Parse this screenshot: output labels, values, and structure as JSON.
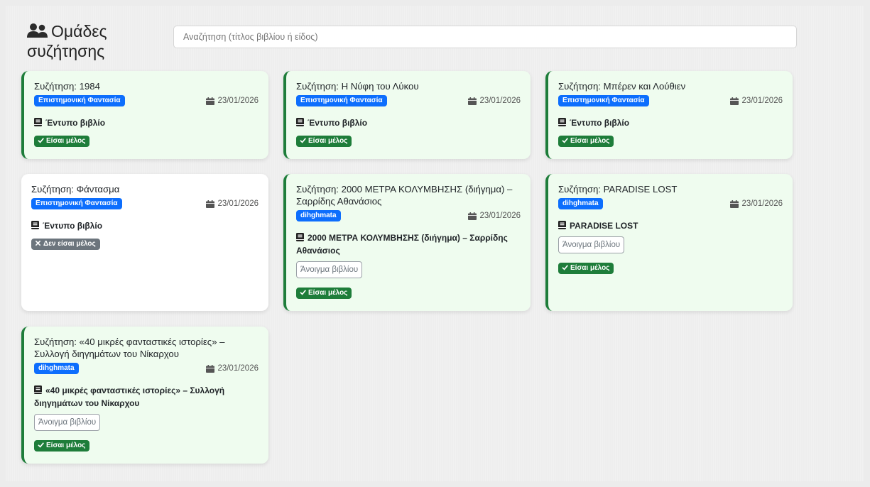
{
  "header": {
    "title": "Ομάδες συζήτησης",
    "title_icon": "users-icon",
    "search_placeholder": "Αναζήτηση (τίτλος βιβλίου ή είδος)"
  },
  "colors": {
    "accent_primary": "#0d6efd",
    "member_green": "#1e7d3a",
    "member_card_bg": "#effcef",
    "nonmember_badge": "#6c757d"
  },
  "cards": [
    {
      "title": "Συζήτηση: 1984",
      "genre": "Επιστημονική Φαντασία",
      "date": "23/01/2026",
      "book": "Έντυπο βιβλίο",
      "open_button": "",
      "status": "Είσαι μέλος",
      "member": true
    },
    {
      "title": "Συζήτηση: Η Νύφη του Λύκου",
      "genre": "Επιστημονική Φαντασία",
      "date": "23/01/2026",
      "book": "Έντυπο βιβλίο",
      "open_button": "",
      "status": "Είσαι μέλος",
      "member": true
    },
    {
      "title": "Συζήτηση: Μπέρεν και Λούθιεν",
      "genre": "Επιστημονική Φαντασία",
      "date": "23/01/2026",
      "book": "Έντυπο βιβλίο",
      "open_button": "",
      "status": "Είσαι μέλος",
      "member": true
    },
    {
      "title": "Συζήτηση: Φάντασμα",
      "genre": "Επιστημονική Φαντασία",
      "date": "23/01/2026",
      "book": "Έντυπο βιβλίο",
      "open_button": "",
      "status": "Δεν είσαι μέλος",
      "member": false
    },
    {
      "title": "Συζήτηση: 2000 ΜΕΤΡΑ ΚΟΛΥΜΒΗΣΗΣ (διήγημα) – Σαρρίδης Αθανάσιος",
      "genre": "dihghmata",
      "date": "23/01/2026",
      "book": "2000 ΜΕΤΡΑ ΚΟΛΥΜΒΗΣΗΣ (διήγημα) – Σαρρίδης Αθανάσιος",
      "open_button": "Άνοιγμα βιβλίου",
      "status": "Είσαι μέλος",
      "member": true
    },
    {
      "title": "Συζήτηση: PARADISE LOST",
      "genre": "dihghmata",
      "date": "23/01/2026",
      "book": "PARADISE LOST",
      "open_button": "Άνοιγμα βιβλίου",
      "status": "Είσαι μέλος",
      "member": true
    },
    {
      "title": "Συζήτηση: «40 μικρές φανταστικές ιστορίες» – Συλλογή διηγημάτων του Νίκαρχου",
      "genre": "dihghmata",
      "date": "23/01/2026",
      "book": "«40 μικρές φανταστικές ιστορίες» – Συλλογή διηγημάτων του Νίκαρχου",
      "open_button": "Άνοιγμα βιβλίου",
      "status": "Είσαι μέλος",
      "member": true
    }
  ]
}
